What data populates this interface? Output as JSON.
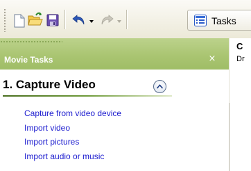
{
  "toolbar": {
    "buttons": [
      {
        "icon": "new-project-icon"
      },
      {
        "icon": "open-project-icon"
      },
      {
        "icon": "save-project-icon"
      },
      {
        "icon": "undo-icon"
      },
      {
        "icon": "redo-icon"
      }
    ],
    "tasks_label": "Tasks",
    "tasks_icon": "tasks-list-icon"
  },
  "task_pane": {
    "title": "Movie Tasks",
    "close_glyph": "×",
    "section": {
      "title": "1. Capture Video",
      "links": [
        "Capture from video device",
        "Import video",
        "Import pictures",
        "Import audio or music"
      ]
    },
    "colors": {
      "header": "#aac572",
      "link": "#1c1ccf",
      "rule": "#4a6f1f"
    }
  },
  "right_panel": {
    "title": "C",
    "subtitle": "Dr"
  }
}
